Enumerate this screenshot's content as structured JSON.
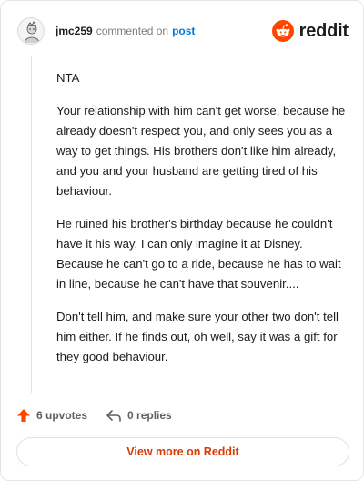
{
  "header": {
    "username": "jmc259",
    "action_text": "commented on",
    "post_link": "post",
    "brand": "reddit"
  },
  "comment": {
    "paragraphs": [
      "NTA",
      "Your relationship with him can't get worse, because he already doesn't respect you, and only sees you as a way to get things. His brothers don't like him already, and you and your husband are getting tired of his behaviour.",
      "He ruined his brother's birthday because he couldn't have it his way, I can only imagine it at Disney. Because he can't go to a ride, because he has to wait in line, because he can't have that souvenir....",
      "Don't tell him, and make sure your other two don't tell him either. If he finds out, oh well, say it was a gift for they good behaviour."
    ]
  },
  "actions": {
    "upvotes": "6 upvotes",
    "replies": "0 replies"
  },
  "footer": {
    "view_more": "View more on Reddit"
  },
  "colors": {
    "brand_orange": "#ff4500",
    "upvote": "#ff4500",
    "link_blue": "#0079d3",
    "button_text": "#d93a00"
  },
  "icons": {
    "avatar": "avatar",
    "brand": "reddit-logo-icon",
    "upvote": "upvote-arrow-icon",
    "reply": "reply-arrow-icon"
  }
}
